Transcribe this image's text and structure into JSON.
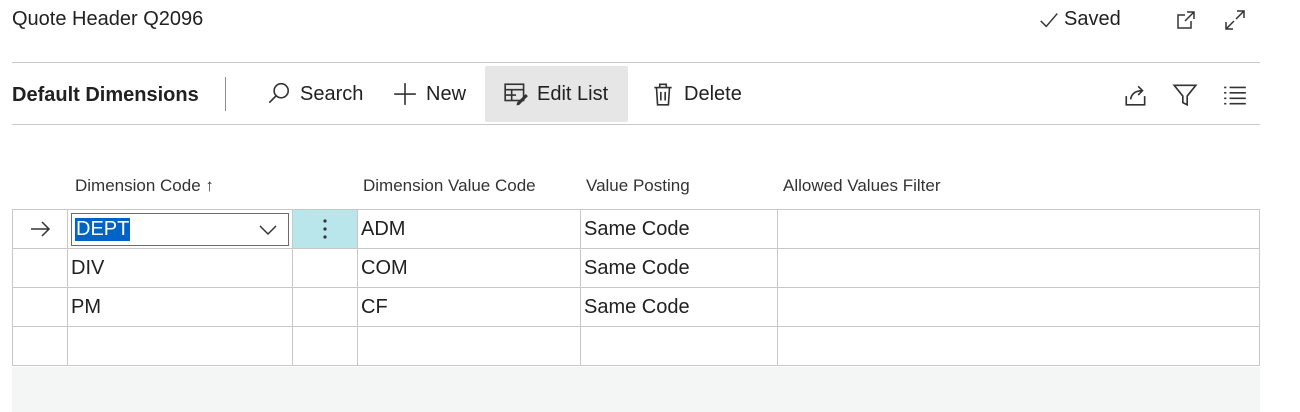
{
  "header": {
    "title": "Quote Header Q2096",
    "saved_label": "Saved",
    "icons": [
      "open-new-window-icon",
      "expand-icon"
    ]
  },
  "actionbar": {
    "section_title": "Default Dimensions",
    "search_label": "Search",
    "new_label": "New",
    "edit_list_label": "Edit List",
    "delete_label": "Delete",
    "right_icons": [
      "share-icon",
      "filter-icon",
      "list-view-icon"
    ]
  },
  "grid": {
    "columns": {
      "dimension_code": "Dimension Code",
      "sort_indicator": "↑",
      "dimension_value_code": "Dimension Value Code",
      "value_posting": "Value Posting",
      "allowed_values_filter": "Allowed Values Filter"
    },
    "rows": [
      {
        "dimension_code": "DEPT",
        "dimension_value_code": "ADM",
        "value_posting": "Same Code",
        "allowed_values_filter": "",
        "current": true
      },
      {
        "dimension_code": "DIV",
        "dimension_value_code": "COM",
        "value_posting": "Same Code",
        "allowed_values_filter": ""
      },
      {
        "dimension_code": "PM",
        "dimension_value_code": "CF",
        "value_posting": "Same Code",
        "allowed_values_filter": ""
      },
      {
        "dimension_code": "",
        "dimension_value_code": "",
        "value_posting": "",
        "allowed_values_filter": ""
      }
    ]
  },
  "colors": {
    "selection": "#0063c6",
    "active_cell": "#b8e6ea",
    "active_action": "#e6e6e6"
  }
}
